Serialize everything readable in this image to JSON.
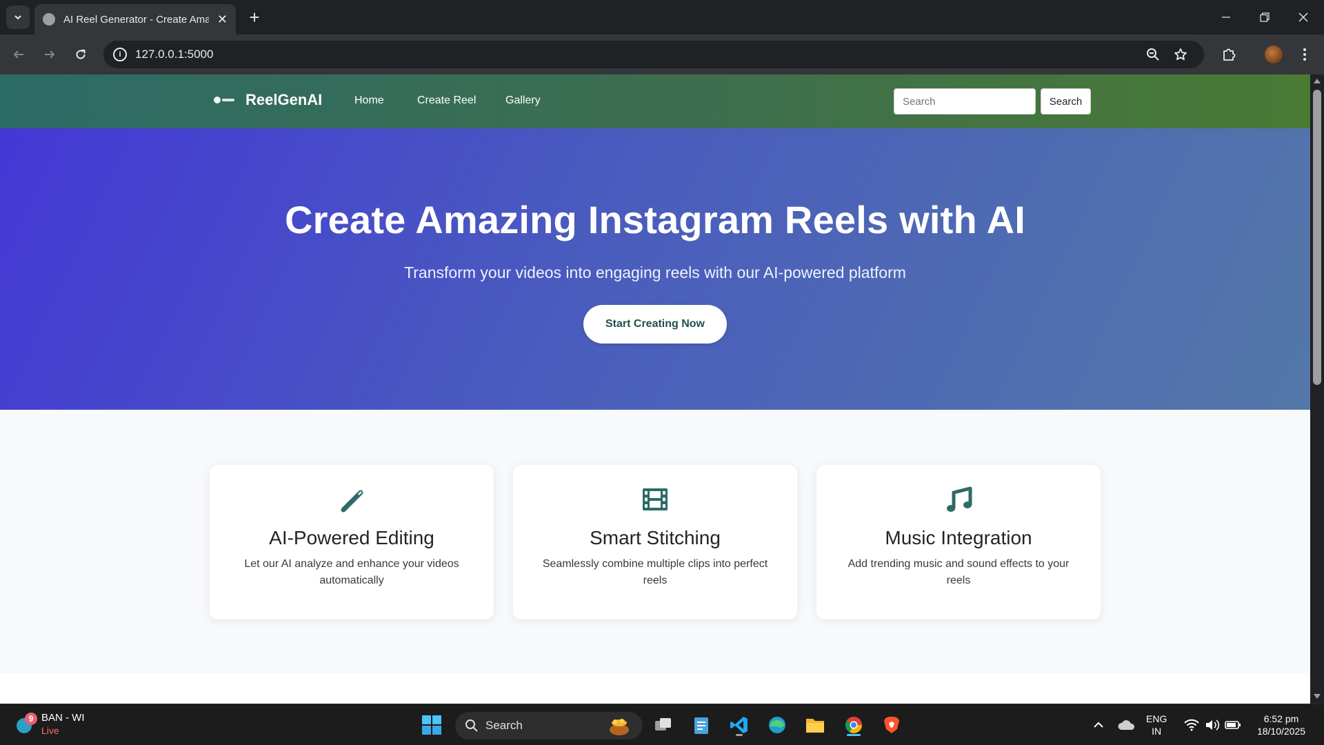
{
  "browser": {
    "tab_title": "AI Reel Generator - Create Ama",
    "url": "127.0.0.1:5000"
  },
  "site": {
    "brand": "ReelGenAI",
    "nav": [
      {
        "label": "Home"
      },
      {
        "label": "Create Reel"
      },
      {
        "label": "Gallery"
      }
    ],
    "search_placeholder": "Search",
    "search_button": "Search",
    "accent_color": "#2d6b66"
  },
  "hero": {
    "title": "Create Amazing Instagram Reels with AI",
    "subtitle": "Transform your videos into engaging reels with our AI-powered platform",
    "cta": "Start Creating Now"
  },
  "features": [
    {
      "icon": "magic-wand-icon",
      "title": "AI-Powered Editing",
      "description": "Let our AI analyze and enhance your videos automatically"
    },
    {
      "icon": "film-icon",
      "title": "Smart Stitching",
      "description": "Seamlessly combine multiple clips into perfect reels"
    },
    {
      "icon": "music-icon",
      "title": "Music Integration",
      "description": "Add trending music and sound effects to your reels"
    }
  ],
  "taskbar": {
    "widget_badge": "9",
    "widget_title": "BAN - WI",
    "widget_status": "Live",
    "search_label": "Search",
    "language_line1": "ENG",
    "language_line2": "IN",
    "time": "6:52 pm",
    "date": "18/10/2025"
  }
}
